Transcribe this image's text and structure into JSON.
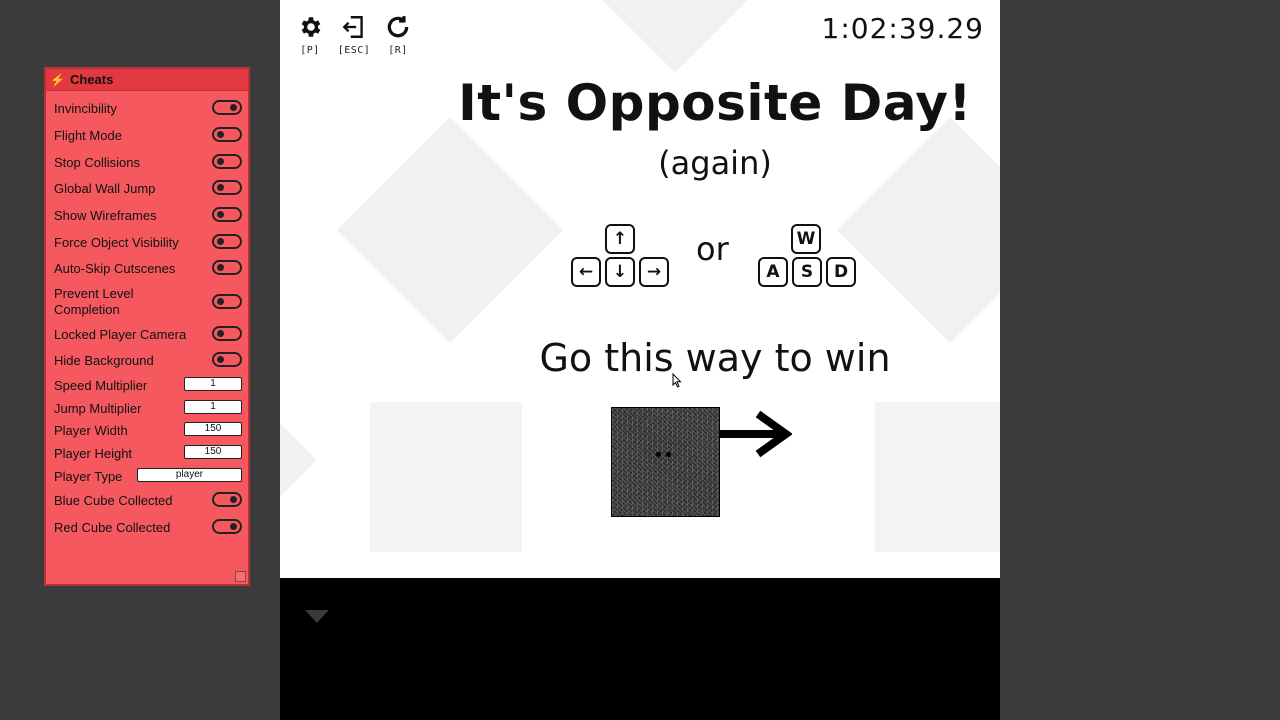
{
  "hud": {
    "settings_key": "[P]",
    "exit_key": "[ESC]",
    "restart_key": "[R]",
    "timer": "1:02:39.29"
  },
  "level": {
    "title": "It's Opposite Day!",
    "subtitle": "(again)",
    "arrow_keys": {
      "up": "↑",
      "left": "←",
      "down": "↓",
      "right": "→"
    },
    "or_text": "or",
    "wasd_keys": {
      "w": "W",
      "a": "A",
      "s": "S",
      "d": "D"
    },
    "hint": "Go this way to win"
  },
  "cheats": {
    "title": "Cheats",
    "toggles": [
      {
        "label": "Invincibility",
        "on": true
      },
      {
        "label": "Flight Mode",
        "on": false
      },
      {
        "label": "Stop Collisions",
        "on": false
      },
      {
        "label": "Global Wall Jump",
        "on": false
      },
      {
        "label": "Show Wireframes",
        "on": false
      },
      {
        "label": "Force Object Visibility",
        "on": false
      },
      {
        "label": "Auto-Skip Cutscenes",
        "on": false
      },
      {
        "label": "Prevent Level Completion",
        "on": false
      },
      {
        "label": "Locked Player Camera",
        "on": false
      },
      {
        "label": "Hide Background",
        "on": false
      }
    ],
    "inputs": [
      {
        "label": "Speed Multiplier",
        "value": "1"
      },
      {
        "label": "Jump Multiplier",
        "value": "1"
      },
      {
        "label": "Player Width",
        "value": "150"
      },
      {
        "label": "Player Height",
        "value": "150"
      },
      {
        "label": "Player Type",
        "value": "player"
      }
    ],
    "collected": [
      {
        "label": "Blue Cube Collected",
        "on": true
      },
      {
        "label": "Red Cube Collected",
        "on": true
      }
    ]
  },
  "colors": {
    "panel": "#f5595f",
    "panel_header": "#e2383f",
    "game_bg": "#ffffff"
  }
}
